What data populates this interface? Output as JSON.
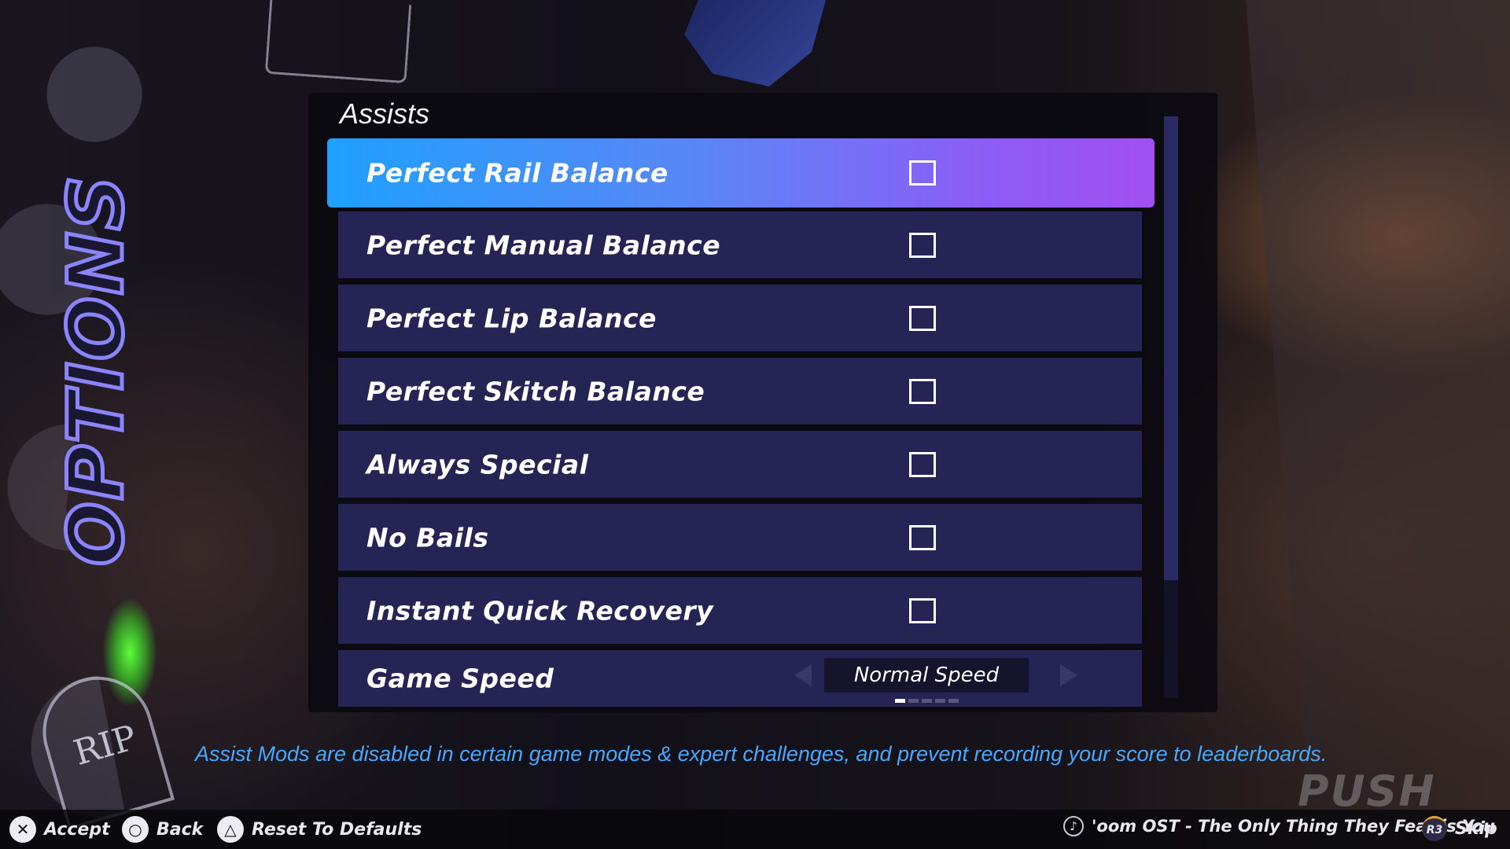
{
  "screen": {
    "side_title": "OPTIONS",
    "panel_title": "Assists"
  },
  "assists": {
    "items": [
      {
        "label": "Perfect Rail Balance",
        "type": "checkbox",
        "checked": false,
        "selected": true
      },
      {
        "label": "Perfect Manual Balance",
        "type": "checkbox",
        "checked": false,
        "selected": false
      },
      {
        "label": "Perfect Lip Balance",
        "type": "checkbox",
        "checked": false,
        "selected": false
      },
      {
        "label": "Perfect Skitch Balance",
        "type": "checkbox",
        "checked": false,
        "selected": false
      },
      {
        "label": "Always Special",
        "type": "checkbox",
        "checked": false,
        "selected": false
      },
      {
        "label": "No Bails",
        "type": "checkbox",
        "checked": false,
        "selected": false
      },
      {
        "label": "Instant Quick Recovery",
        "type": "checkbox",
        "checked": false,
        "selected": false
      }
    ],
    "game_speed": {
      "label": "Game Speed",
      "value": "Normal Speed",
      "option_count": 5,
      "active_index": 0
    }
  },
  "note": "Assist Mods are disabled in certain game modes & expert challenges, and prevent recording your score to leaderboards.",
  "decor": {
    "tombstone_text": "RIP",
    "watermark": "PUSH"
  },
  "footer": {
    "accept": {
      "glyph": "✕",
      "label": "Accept"
    },
    "back": {
      "glyph": "○",
      "label": "Back"
    },
    "reset": {
      "glyph": "△",
      "label": "Reset To Defaults"
    },
    "now_playing": "'oom OST - The Only Thing They Fear is You",
    "skip": {
      "glyph": "R3",
      "label": "Skip"
    }
  },
  "colors": {
    "highlight_start": "#1fa0ff",
    "highlight_end": "#a24ff0",
    "row_bg": "#262454",
    "note_text": "#4aa6ff"
  }
}
